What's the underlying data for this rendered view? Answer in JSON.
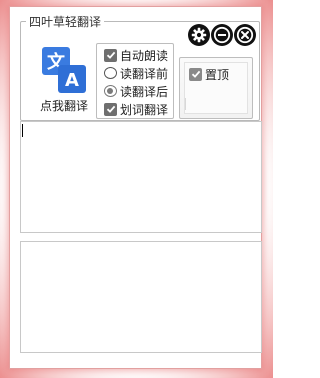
{
  "window": {
    "group_title": "四叶草轻翻译",
    "accent_color": "#3a7be0",
    "border_glow_color": "#ec8f8f"
  },
  "title_buttons": {
    "settings_icon": "gear-icon",
    "minimize_icon": "minus-circle-icon",
    "close_icon": "close-circle-icon"
  },
  "logo": {
    "icon": "translate-icon",
    "caption": "点我翻译"
  },
  "options": {
    "auto_read": {
      "label": "自动朗读",
      "checked": true
    },
    "read_before": {
      "label": "读翻译前",
      "selected": false
    },
    "read_after": {
      "label": "读翻译后",
      "selected": true
    },
    "select_translate": {
      "label": "划词翻译",
      "checked": true
    }
  },
  "pin": {
    "label": "置顶",
    "checked": true
  },
  "source_text": {
    "value": ""
  },
  "result_text": {
    "value": ""
  }
}
